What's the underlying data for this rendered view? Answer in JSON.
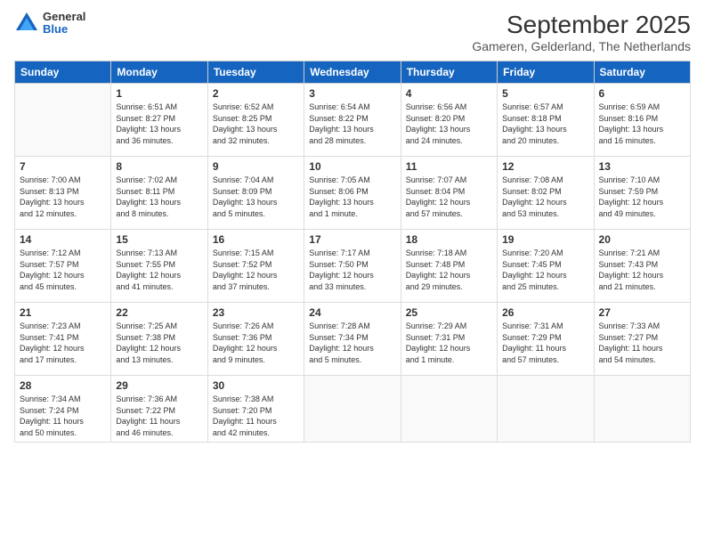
{
  "header": {
    "logo": {
      "general": "General",
      "blue": "Blue"
    },
    "title": "September 2025",
    "subtitle": "Gameren, Gelderland, The Netherlands"
  },
  "days": [
    "Sunday",
    "Monday",
    "Tuesday",
    "Wednesday",
    "Thursday",
    "Friday",
    "Saturday"
  ],
  "weeks": [
    [
      {
        "day": "",
        "info": ""
      },
      {
        "day": "1",
        "info": "Sunrise: 6:51 AM\nSunset: 8:27 PM\nDaylight: 13 hours\nand 36 minutes."
      },
      {
        "day": "2",
        "info": "Sunrise: 6:52 AM\nSunset: 8:25 PM\nDaylight: 13 hours\nand 32 minutes."
      },
      {
        "day": "3",
        "info": "Sunrise: 6:54 AM\nSunset: 8:22 PM\nDaylight: 13 hours\nand 28 minutes."
      },
      {
        "day": "4",
        "info": "Sunrise: 6:56 AM\nSunset: 8:20 PM\nDaylight: 13 hours\nand 24 minutes."
      },
      {
        "day": "5",
        "info": "Sunrise: 6:57 AM\nSunset: 8:18 PM\nDaylight: 13 hours\nand 20 minutes."
      },
      {
        "day": "6",
        "info": "Sunrise: 6:59 AM\nSunset: 8:16 PM\nDaylight: 13 hours\nand 16 minutes."
      }
    ],
    [
      {
        "day": "7",
        "info": "Sunrise: 7:00 AM\nSunset: 8:13 PM\nDaylight: 13 hours\nand 12 minutes."
      },
      {
        "day": "8",
        "info": "Sunrise: 7:02 AM\nSunset: 8:11 PM\nDaylight: 13 hours\nand 8 minutes."
      },
      {
        "day": "9",
        "info": "Sunrise: 7:04 AM\nSunset: 8:09 PM\nDaylight: 13 hours\nand 5 minutes."
      },
      {
        "day": "10",
        "info": "Sunrise: 7:05 AM\nSunset: 8:06 PM\nDaylight: 13 hours\nand 1 minute."
      },
      {
        "day": "11",
        "info": "Sunrise: 7:07 AM\nSunset: 8:04 PM\nDaylight: 12 hours\nand 57 minutes."
      },
      {
        "day": "12",
        "info": "Sunrise: 7:08 AM\nSunset: 8:02 PM\nDaylight: 12 hours\nand 53 minutes."
      },
      {
        "day": "13",
        "info": "Sunrise: 7:10 AM\nSunset: 7:59 PM\nDaylight: 12 hours\nand 49 minutes."
      }
    ],
    [
      {
        "day": "14",
        "info": "Sunrise: 7:12 AM\nSunset: 7:57 PM\nDaylight: 12 hours\nand 45 minutes."
      },
      {
        "day": "15",
        "info": "Sunrise: 7:13 AM\nSunset: 7:55 PM\nDaylight: 12 hours\nand 41 minutes."
      },
      {
        "day": "16",
        "info": "Sunrise: 7:15 AM\nSunset: 7:52 PM\nDaylight: 12 hours\nand 37 minutes."
      },
      {
        "day": "17",
        "info": "Sunrise: 7:17 AM\nSunset: 7:50 PM\nDaylight: 12 hours\nand 33 minutes."
      },
      {
        "day": "18",
        "info": "Sunrise: 7:18 AM\nSunset: 7:48 PM\nDaylight: 12 hours\nand 29 minutes."
      },
      {
        "day": "19",
        "info": "Sunrise: 7:20 AM\nSunset: 7:45 PM\nDaylight: 12 hours\nand 25 minutes."
      },
      {
        "day": "20",
        "info": "Sunrise: 7:21 AM\nSunset: 7:43 PM\nDaylight: 12 hours\nand 21 minutes."
      }
    ],
    [
      {
        "day": "21",
        "info": "Sunrise: 7:23 AM\nSunset: 7:41 PM\nDaylight: 12 hours\nand 17 minutes."
      },
      {
        "day": "22",
        "info": "Sunrise: 7:25 AM\nSunset: 7:38 PM\nDaylight: 12 hours\nand 13 minutes."
      },
      {
        "day": "23",
        "info": "Sunrise: 7:26 AM\nSunset: 7:36 PM\nDaylight: 12 hours\nand 9 minutes."
      },
      {
        "day": "24",
        "info": "Sunrise: 7:28 AM\nSunset: 7:34 PM\nDaylight: 12 hours\nand 5 minutes."
      },
      {
        "day": "25",
        "info": "Sunrise: 7:29 AM\nSunset: 7:31 PM\nDaylight: 12 hours\nand 1 minute."
      },
      {
        "day": "26",
        "info": "Sunrise: 7:31 AM\nSunset: 7:29 PM\nDaylight: 11 hours\nand 57 minutes."
      },
      {
        "day": "27",
        "info": "Sunrise: 7:33 AM\nSunset: 7:27 PM\nDaylight: 11 hours\nand 54 minutes."
      }
    ],
    [
      {
        "day": "28",
        "info": "Sunrise: 7:34 AM\nSunset: 7:24 PM\nDaylight: 11 hours\nand 50 minutes."
      },
      {
        "day": "29",
        "info": "Sunrise: 7:36 AM\nSunset: 7:22 PM\nDaylight: 11 hours\nand 46 minutes."
      },
      {
        "day": "30",
        "info": "Sunrise: 7:38 AM\nSunset: 7:20 PM\nDaylight: 11 hours\nand 42 minutes."
      },
      {
        "day": "",
        "info": ""
      },
      {
        "day": "",
        "info": ""
      },
      {
        "day": "",
        "info": ""
      },
      {
        "day": "",
        "info": ""
      }
    ]
  ]
}
